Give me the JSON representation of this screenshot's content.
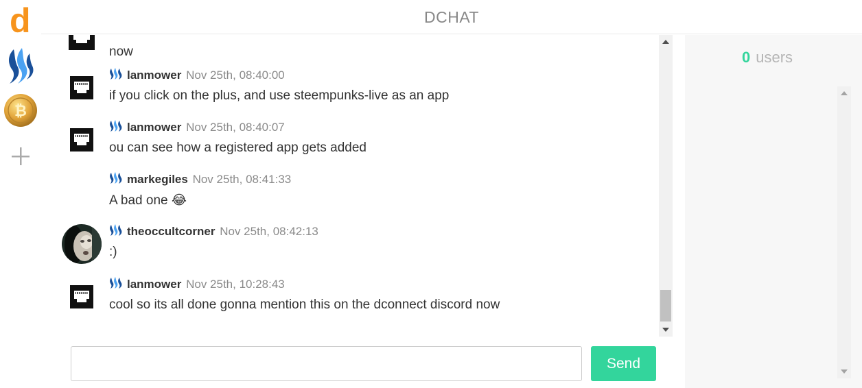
{
  "apps": {
    "dconnect_letter": "d",
    "items": [
      {
        "icon": "d-logo-icon"
      },
      {
        "icon": "steem-logo-icon"
      },
      {
        "icon": "bitcoin-logo-icon"
      },
      {
        "icon": "plus-icon"
      }
    ],
    "add_label": "+"
  },
  "header": {
    "title": "DCHAT"
  },
  "messages": [
    {
      "avatar": "ethernet-icon",
      "user": "",
      "time": "",
      "text": "now",
      "partial": true
    },
    {
      "avatar": "ethernet-icon",
      "user": "lanmower",
      "time": "Nov 25th, 08:40:00",
      "text": "if you click on the plus, and use steempunks-live as an app"
    },
    {
      "avatar": "ethernet-icon",
      "user": "lanmower",
      "time": "Nov 25th, 08:40:07",
      "text": "ou can see how a registered app gets added"
    },
    {
      "avatar": "",
      "user": "markegiles",
      "time": "Nov 25th, 08:41:33",
      "text": "A bad one 😂"
    },
    {
      "avatar": "user-photo",
      "user": "theoccultcorner",
      "time": "Nov 25th, 08:42:13",
      "text": ":)"
    },
    {
      "avatar": "ethernet-icon",
      "user": "lanmower",
      "time": "Nov 25th, 10:28:43",
      "text": "cool so its all done gonna mention this on the dconnect discord now"
    }
  ],
  "composer": {
    "value": "",
    "placeholder": "",
    "send_label": "Send"
  },
  "users_panel": {
    "count": "0",
    "label": "users"
  },
  "colors": {
    "accent": "#33d59c",
    "dconnect": "#f7941d",
    "steem": "#1a5099"
  }
}
